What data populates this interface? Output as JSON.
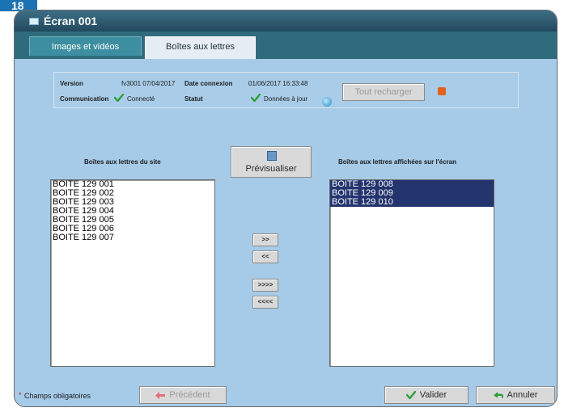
{
  "badge": "18",
  "window": {
    "title": "Écran 001"
  },
  "tabs": [
    {
      "label": "Images et vidéos"
    },
    {
      "label": "Boîtes aux lettres"
    }
  ],
  "info": {
    "version_label": "Version",
    "version_value": "fv3001 07/04/2017",
    "connection_label": "Date connexion",
    "connection_value": "01/06/2017 16:33:48",
    "communication_label": "Communication",
    "communication_value": "Connecté",
    "status_label": "Statut",
    "status_value": "Données à jour",
    "reload_label": "Tout recharger"
  },
  "left_list": {
    "heading": "Boîtes aux lettres du site",
    "items": [
      "BOITE 129 001",
      "BOITE 129 002",
      "BOITE 129 003",
      "BOITE 129 004",
      "BOITE 129 005",
      "BOITE 129 006",
      "BOITE 129 007"
    ]
  },
  "right_list": {
    "heading": "Boîtes aux lettres affichées sur l'écran",
    "items": [
      "BOITE 129 008",
      "BOITE 129 009",
      "BOITE 129 010"
    ]
  },
  "buttons": {
    "preview": "Prévisualiser",
    "move_right": ">>",
    "move_left": "<<",
    "move_all_right": ">>>>",
    "move_all_left": "<<<<",
    "previous": "Précédent",
    "validate": "Valider",
    "cancel": "Annuler"
  },
  "footer": {
    "star": "*",
    "required": "Champs obligatoires"
  },
  "colors": {
    "accent": "#1b73b3",
    "background": "#a6cbe8",
    "selection": "#23346e",
    "check": "#2e9e3a"
  }
}
